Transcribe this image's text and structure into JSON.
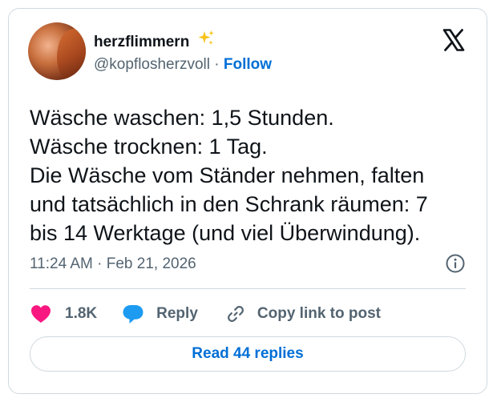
{
  "author": {
    "display_name": "herzflimmern",
    "display_name_emoji": "sparkles-icon",
    "handle": "@kopflosherzvoll",
    "separator": "·",
    "follow_label": "Follow"
  },
  "platform_logo": "x-logo-icon",
  "tweet": {
    "lines": [
      "Wäsche waschen: 1,5 Stunden.",
      "Wäsche trocknen: 1 Tag.",
      "Die Wäsche vom Ständer nehmen, falten",
      "und tatsächlich in den Schrank räumen: 7",
      "bis 14 Werktage (und viel Überwindung)."
    ],
    "timestamp": "11:24 AM · Feb 21, 2026"
  },
  "actions": {
    "like_count": "1.8K",
    "reply_label": "Reply",
    "copy_label": "Copy link to post"
  },
  "read_replies_label": "Read 44 replies",
  "colors": {
    "link_blue": "#006fd6",
    "like_pink": "#f91880",
    "reply_blue": "#1d9bf0",
    "text_primary": "#0f1419",
    "text_secondary": "#536471",
    "border": "#cfd9de"
  }
}
